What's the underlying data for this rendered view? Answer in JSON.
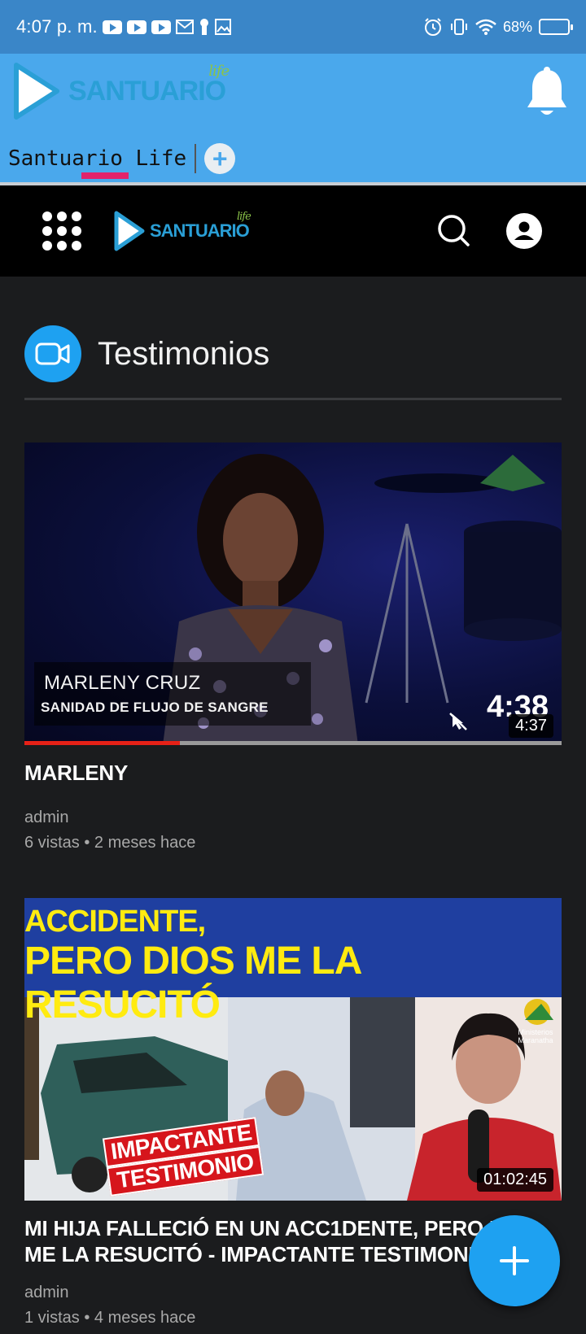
{
  "status_bar": {
    "time": "4:07 p. m.",
    "battery": "68%"
  },
  "app_bar": {
    "brand": "SANTUARIO",
    "brand_script": "life",
    "tab_label": "Santuario Life",
    "add_tab": "+"
  },
  "site_header": {
    "brand": "SANTUARIO",
    "brand_script": "life"
  },
  "section": {
    "title": "Testimonios"
  },
  "videos": [
    {
      "thumb_name": "MARLENY CRUZ",
      "thumb_subtitle": "SANIDAD DE FLUJO DE SANGRE",
      "thumb_big_time": "4:38",
      "duration": "4:37",
      "progress": 0.29,
      "title": "MARLENY",
      "author": "admin",
      "meta": "6 vistas • 2 meses hace"
    },
    {
      "banner_line1": "MI HIJA FALLECIÓ EN UN ACCIDENTE,",
      "banner_line2": "PERO DIOS ME LA RESUCITÓ",
      "stamp_line1": "IMPACTANTE",
      "stamp_line2": "TESTIMONIO",
      "channel_badge": "Ministerios Maranatha",
      "duration": "01:02:45",
      "title": "MI HIJA FALLECIÓ EN UN ACC1DENTE, PERO DIOS ME LA RESUCITÓ - IMPACTANTE TESTIMONIO",
      "author": "admin",
      "meta": "1 vistas • 4 meses hace"
    }
  ],
  "fab": {
    "label": "+"
  },
  "colors": {
    "status_bar": "#3a86c8",
    "app_bar": "#4aa8ec",
    "accent": "#1ea1f1",
    "tab_indicator": "#e2236b",
    "background": "#1b1c1e"
  }
}
